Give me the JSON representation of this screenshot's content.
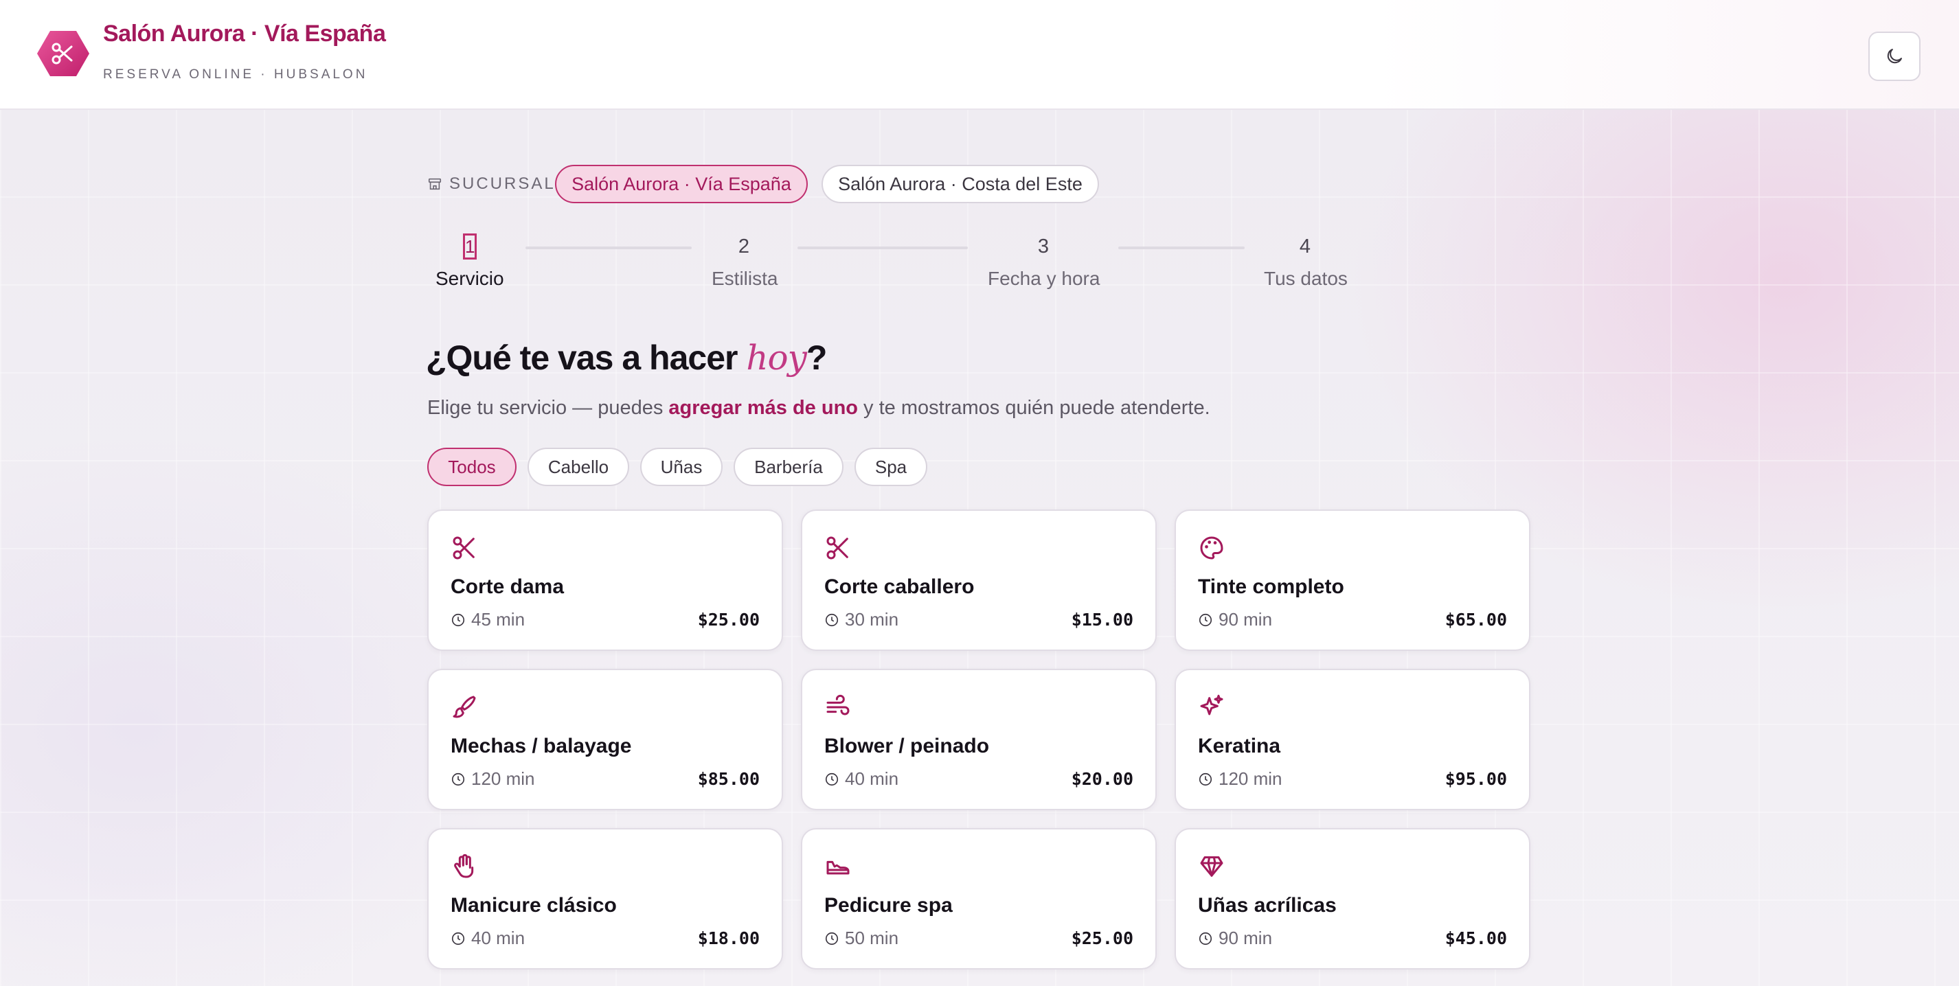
{
  "header": {
    "title": "Salón Aurora · Vía España",
    "subtitle": "RESERVA ONLINE · HUBSALON",
    "theme_toggle_icon": "moon-icon",
    "logo_icon": "scissors-icon"
  },
  "branch": {
    "label": "SUCURSAL",
    "options": [
      {
        "label": "Salón Aurora · Vía España",
        "selected": true
      },
      {
        "label": "Salón Aurora · Costa del Este",
        "selected": false
      }
    ]
  },
  "steps": [
    {
      "number": "1",
      "label": "Servicio",
      "active": true
    },
    {
      "number": "2",
      "label": "Estilista",
      "active": false
    },
    {
      "number": "3",
      "label": "Fecha y hora",
      "active": false
    },
    {
      "number": "4",
      "label": "Tus datos",
      "active": false
    }
  ],
  "heading": {
    "before": "¿Qué te vas a hacer ",
    "emphasis": "hoy",
    "after": "?"
  },
  "lead": {
    "before": "Elige tu servicio — puedes ",
    "bold": "agregar más de uno",
    "after": " y te mostramos quién puede atenderte."
  },
  "filters": [
    {
      "label": "Todos",
      "active": true
    },
    {
      "label": "Cabello",
      "active": false
    },
    {
      "label": "Uñas",
      "active": false
    },
    {
      "label": "Barbería",
      "active": false
    },
    {
      "label": "Spa",
      "active": false
    }
  ],
  "services": [
    {
      "name": "Corte dama",
      "duration": "45 min",
      "price": "$25.00",
      "icon": "scissors-icon"
    },
    {
      "name": "Corte caballero",
      "duration": "30 min",
      "price": "$15.00",
      "icon": "scissors-icon"
    },
    {
      "name": "Tinte completo",
      "duration": "90 min",
      "price": "$65.00",
      "icon": "palette-icon"
    },
    {
      "name": "Mechas / balayage",
      "duration": "120 min",
      "price": "$85.00",
      "icon": "brush-icon"
    },
    {
      "name": "Blower / peinado",
      "duration": "40 min",
      "price": "$20.00",
      "icon": "wind-icon"
    },
    {
      "name": "Keratina",
      "duration": "120 min",
      "price": "$95.00",
      "icon": "sparkles-icon"
    },
    {
      "name": "Manicure clásico",
      "duration": "40 min",
      "price": "$18.00",
      "icon": "hand-icon"
    },
    {
      "name": "Pedicure spa",
      "duration": "50 min",
      "price": "$25.00",
      "icon": "foot-icon"
    },
    {
      "name": "Uñas acrílicas",
      "duration": "90 min",
      "price": "$45.00",
      "icon": "gem-icon"
    }
  ],
  "colors": {
    "accent": "#a3195b",
    "accent_soft": "#f7d6e5",
    "text": "#16121a",
    "muted": "#6d6874"
  }
}
